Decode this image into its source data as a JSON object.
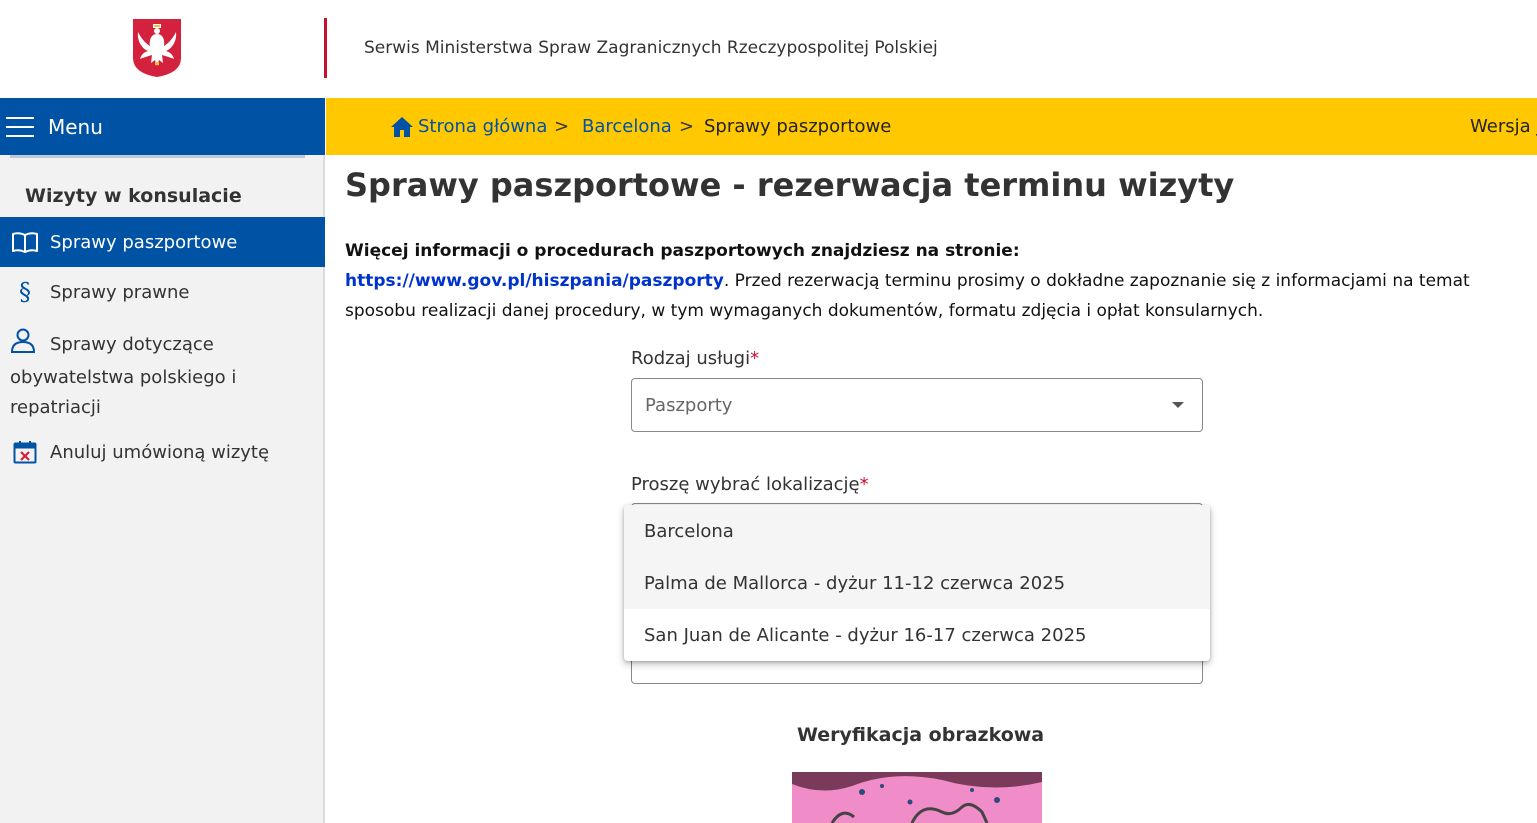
{
  "header": {
    "site_title": "Serwis Ministerstwa Spraw Zagranicznych Rzeczypospolitej Polskiej",
    "emblem_icon": "polish-eagle-emblem",
    "accent_color": "#c8102e"
  },
  "menu": {
    "label": "Menu",
    "color": "#0052a5"
  },
  "sidebar": {
    "heading": "Wizyty w konsulacie",
    "items": [
      {
        "label": "Sprawy paszportowe",
        "icon": "book-icon",
        "active": true
      },
      {
        "label": "Sprawy prawne",
        "icon": "paragraph-icon",
        "active": false
      },
      {
        "label_line1": "Sprawy dotyczące",
        "label_line2": "obywatelstwa polskiego i",
        "label_line3": "repatriacji",
        "icon": "person-icon",
        "active": false
      },
      {
        "label": "Anuluj umówioną wizytę",
        "icon": "calendar-cancel-icon",
        "active": false
      }
    ]
  },
  "breadcrumb": {
    "home": "Strona główna",
    "sep": ">",
    "city": "Barcelona",
    "current": "Sprawy paszportowe",
    "version": "Wersja j",
    "bar_color": "#ffc800"
  },
  "main": {
    "title": "Sprawy paszportowe - rezerwacja terminu wizyty",
    "info_bold": "Więcej informacji o procedurach paszportowych znajdziesz na stronie:",
    "info_link": "https://www.gov.pl/hiszpania/paszporty",
    "info_text": ". Przed rezerwacją terminu prosimy o dokładne zapoznanie się z informacjami na temat sposobu realizacji danej procedury, w tym wymaganych dokumentów, formatu zdjęcia i opłat konsularnych."
  },
  "form": {
    "service_label": "Rodzaj usługi",
    "required_mark": "*",
    "service_value": "Paszporty",
    "location_label": "Proszę wybrać lokalizację",
    "location_options": [
      "Barcelona",
      "Palma de Mallorca - dyżur 11-12 czerwca 2025",
      "San Juan de Alicante - dyżur 16-17 czerwca 2025"
    ],
    "verification_title": "Weryfikacja obrazkowa"
  }
}
